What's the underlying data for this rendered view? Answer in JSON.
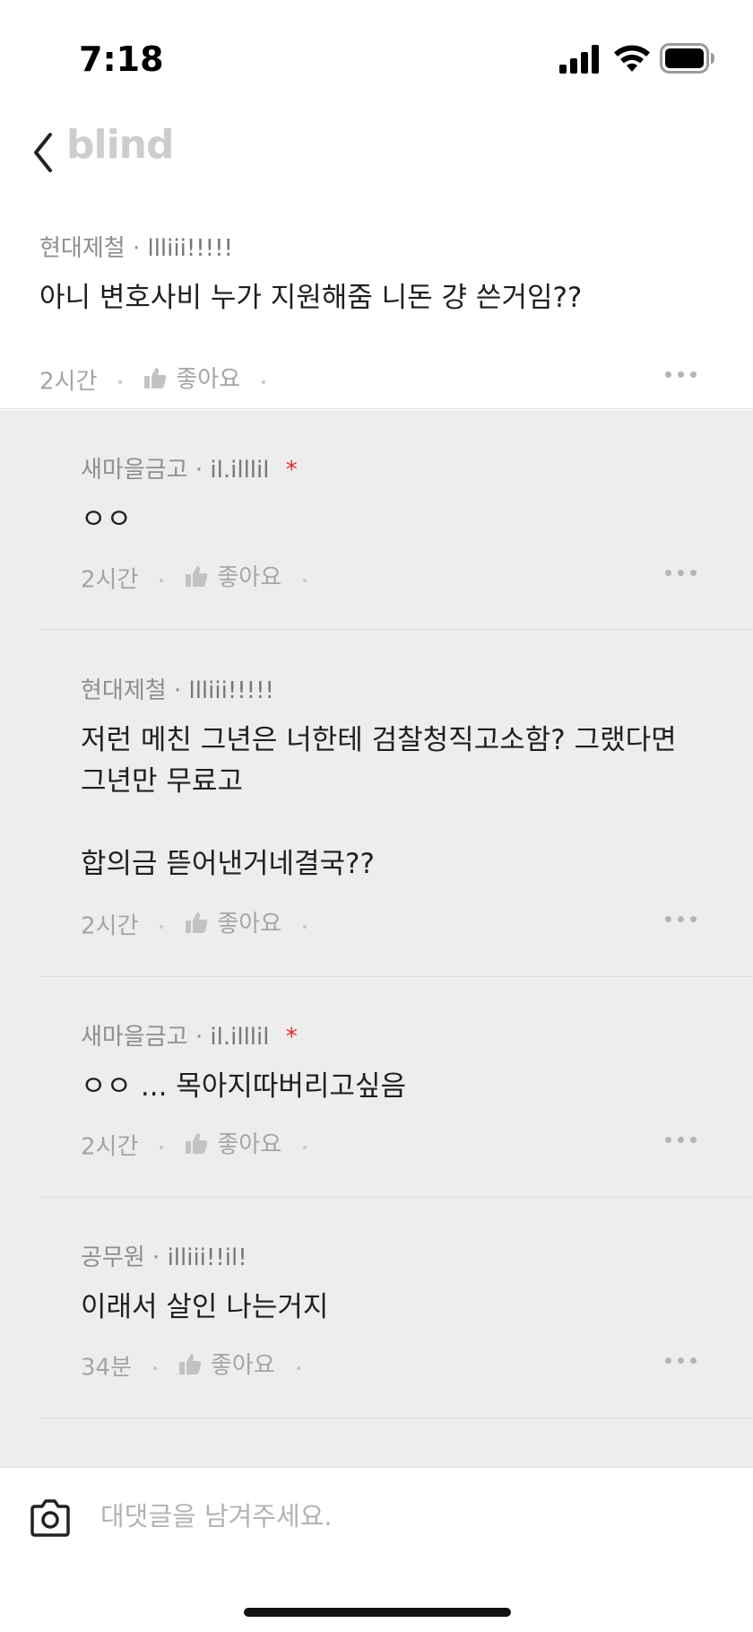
{
  "status_bar": {
    "time": "7:18"
  },
  "nav": {
    "logo": "blind"
  },
  "parent_comment": {
    "company": "현대제철",
    "nickname": "llliii!!!!!",
    "text": "아니 변호사비 누가 지원해줌 니돈 걍 쓴거임??",
    "time": "2시간",
    "like_label": "좋아요"
  },
  "replies": [
    {
      "company": "새마을금고",
      "nickname": "il.illlil",
      "author_mark": "*",
      "text": "ㅇㅇ",
      "time": "2시간",
      "like_label": "좋아요"
    },
    {
      "company": "현대제철",
      "nickname": "llliii!!!!!",
      "text_lines": [
        "저런 메친 그년은 너한테  검찰청직고소함? 그랬다면",
        "그년만 무료고",
        "",
        "합의금 뜯어낸거네결국??"
      ],
      "time": "2시간",
      "like_label": "좋아요"
    },
    {
      "company": "새마을금고",
      "nickname": "il.illlil",
      "author_mark": "*",
      "text": "ㅇㅇ ... 목아지따버리고싶음",
      "time": "2시간",
      "like_label": "좋아요"
    },
    {
      "company": "공무원",
      "nickname": "illiii!!il!",
      "text": "이래서 살인 나는거지",
      "time": "34분",
      "like_label": "좋아요"
    }
  ],
  "input_bar": {
    "placeholder": "대댓글을 남겨주세요."
  },
  "colors": {
    "author_mark": "#e5281f",
    "reply_bg": "#ededed",
    "logo": "#cdcdcd"
  }
}
